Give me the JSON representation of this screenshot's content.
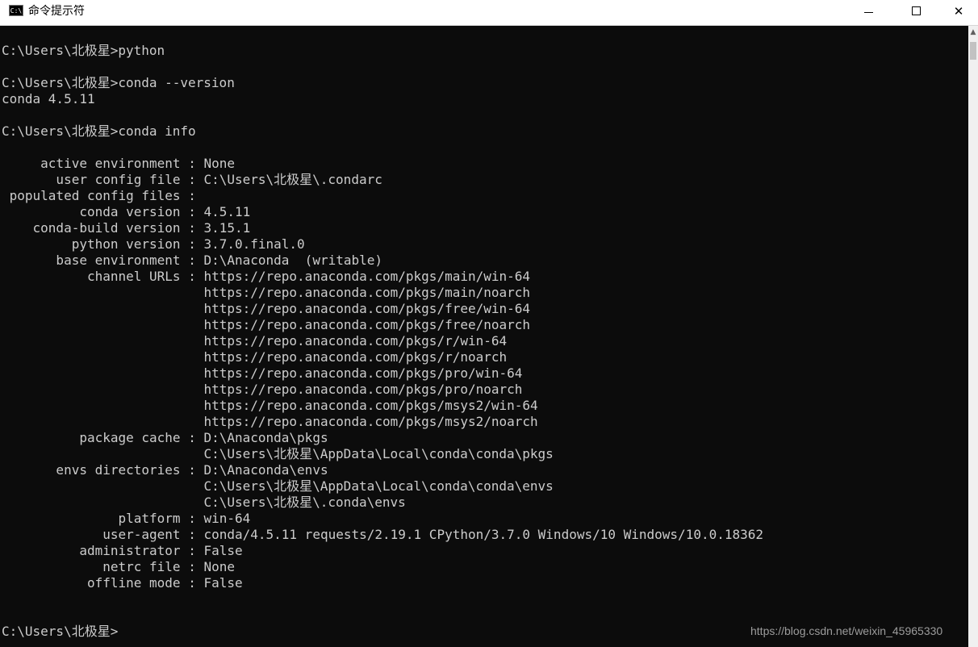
{
  "window": {
    "title": "命令提示符",
    "icon_text": "C:\\",
    "minimize_icon": "minimize-icon",
    "maximize_icon": "maximize-icon",
    "close_icon": "close-icon",
    "close_glyph": "✕"
  },
  "console": {
    "text": "C:\\Users\\北极星>python\n\nC:\\Users\\北极星>conda --version\nconda 4.5.11\n\nC:\\Users\\北极星>conda info\n\n     active environment : None\n       user config file : C:\\Users\\北极星\\.condarc\n populated config files :\n          conda version : 4.5.11\n    conda-build version : 3.15.1\n         python version : 3.7.0.final.0\n       base environment : D:\\Anaconda  (writable)\n           channel URLs : https://repo.anaconda.com/pkgs/main/win-64\n                          https://repo.anaconda.com/pkgs/main/noarch\n                          https://repo.anaconda.com/pkgs/free/win-64\n                          https://repo.anaconda.com/pkgs/free/noarch\n                          https://repo.anaconda.com/pkgs/r/win-64\n                          https://repo.anaconda.com/pkgs/r/noarch\n                          https://repo.anaconda.com/pkgs/pro/win-64\n                          https://repo.anaconda.com/pkgs/pro/noarch\n                          https://repo.anaconda.com/pkgs/msys2/win-64\n                          https://repo.anaconda.com/pkgs/msys2/noarch\n          package cache : D:\\Anaconda\\pkgs\n                          C:\\Users\\北极星\\AppData\\Local\\conda\\conda\\pkgs\n       envs directories : D:\\Anaconda\\envs\n                          C:\\Users\\北极星\\AppData\\Local\\conda\\conda\\envs\n                          C:\\Users\\北极星\\.conda\\envs\n               platform : win-64\n             user-agent : conda/4.5.11 requests/2.19.1 CPython/3.7.0 Windows/10 Windows/10.0.18362\n          administrator : False\n             netrc file : None\n           offline mode : False\n\n\nC:\\Users\\北极星>",
    "text_color": "#cccccc",
    "background": "#0c0c0c"
  },
  "watermark": "https://blog.csdn.net/weixin_45965330"
}
